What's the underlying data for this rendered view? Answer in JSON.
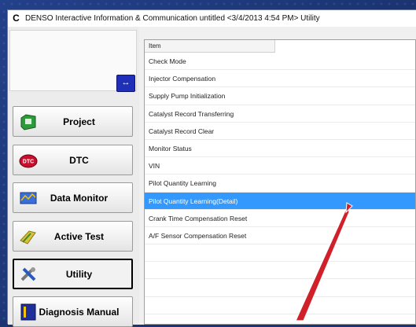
{
  "window": {
    "title": "DENSO Interactive Information & Communication untitled <3/4/2013 4:54 PM> Utility",
    "app_icon_letter": "C"
  },
  "sidebar": {
    "swap_icon": "↔",
    "items": [
      {
        "label": "Project",
        "icon": "project-icon",
        "active": false
      },
      {
        "label": "DTC",
        "icon": "dtc-icon",
        "active": false
      },
      {
        "label": "Data Monitor",
        "icon": "data-monitor-icon",
        "active": false
      },
      {
        "label": "Active Test",
        "icon": "active-test-icon",
        "active": false
      },
      {
        "label": "Utility",
        "icon": "utility-icon",
        "active": true
      },
      {
        "label": "Diagnosis Manual",
        "icon": "diagnosis-manual-icon",
        "active": false
      }
    ]
  },
  "list": {
    "column_header": "Item",
    "selected_index": 8,
    "rows": [
      "Check Mode",
      "Injector Compensation",
      "Supply Pump Initialization",
      "Catalyst Record Transferring",
      "Catalyst Record Clear",
      "Monitor Status",
      "VIN",
      "Pilot Quantity Learning",
      "Pilot Quantity Learning(Detail)",
      "Crank Time Compensation Reset",
      "A/F Sensor Compensation Reset"
    ]
  },
  "colors": {
    "background": "#1c3470",
    "selection": "#3399ff",
    "annotation_arrow": "#d0202a"
  }
}
